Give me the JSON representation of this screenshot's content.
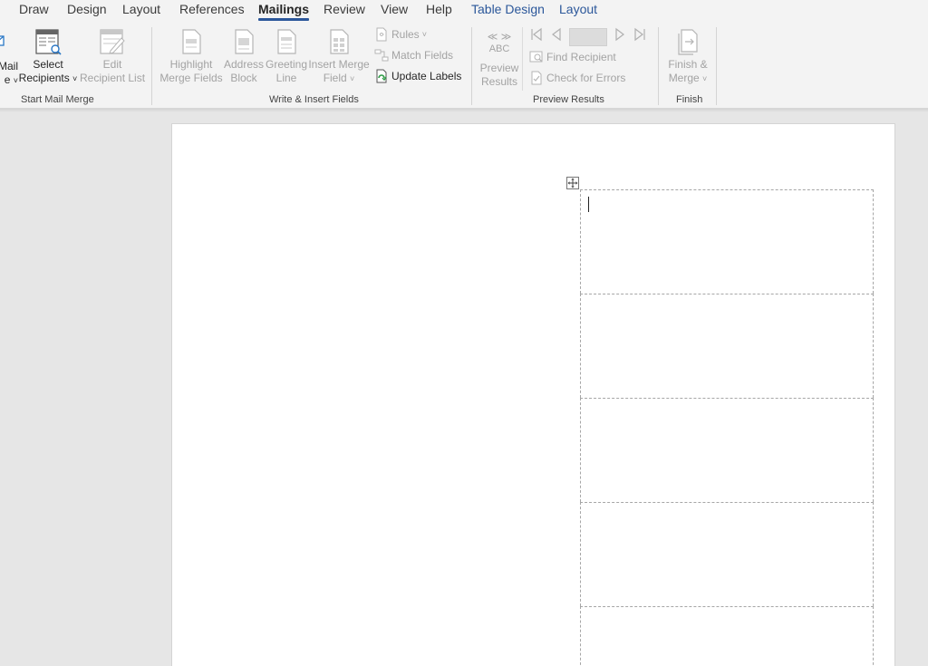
{
  "tabs": [
    {
      "label": "Draw"
    },
    {
      "label": "Design"
    },
    {
      "label": "Layout"
    },
    {
      "label": "References"
    },
    {
      "label": "Mailings"
    },
    {
      "label": "Review"
    },
    {
      "label": "View"
    },
    {
      "label": "Help"
    },
    {
      "label": "Table Design"
    },
    {
      "label": "Layout"
    }
  ],
  "active_tab": "Mailings",
  "ribbon": {
    "start_mail_merge": {
      "group_label": "Start Mail Merge",
      "start_merge": {
        "line1": "Mail",
        "line2": "e"
      },
      "select_recipients": {
        "line1": "Select",
        "line2": "Recipients"
      },
      "edit_recipient_list": {
        "line1": "Edit",
        "line2": "Recipient List"
      }
    },
    "write_insert": {
      "group_label": "Write & Insert Fields",
      "highlight": {
        "line1": "Highlight",
        "line2": "Merge Fields"
      },
      "address_block": {
        "line1": "Address",
        "line2": "Block"
      },
      "greeting_line": {
        "line1": "Greeting",
        "line2": "Line"
      },
      "insert_merge_field": {
        "line1": "Insert Merge",
        "line2": "Field"
      },
      "rules": "Rules",
      "match_fields": "Match Fields",
      "update_labels": "Update Labels"
    },
    "preview": {
      "group_label": "Preview Results",
      "abc": "ABC",
      "preview_results": {
        "line1": "Preview",
        "line2": "Results"
      },
      "find_recipient": "Find Recipient",
      "check_errors": "Check for Errors"
    },
    "finish": {
      "group_label": "Finish",
      "finish_merge": {
        "line1": "Finish &",
        "line2": "Merge"
      }
    }
  },
  "colors": {
    "accent": "#2b579a",
    "disabled": "#a3a3a3"
  }
}
